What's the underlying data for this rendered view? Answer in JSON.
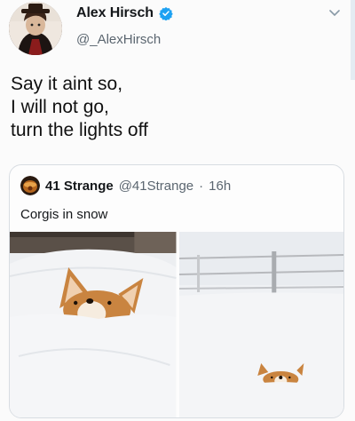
{
  "author": {
    "display_name": "Alex Hirsch",
    "handle": "@_AlexHirsch",
    "avatar_icon": "profile-avatar",
    "verified_icon": "verified-badge-icon"
  },
  "tweet": {
    "lines": [
      "Say it aint so,",
      "I will not go,",
      "turn the lights off"
    ]
  },
  "quoted": {
    "display_name": "41 Strange",
    "handle": "@41Strange",
    "separator": "·",
    "time": "16h",
    "text": "Corgis in snow",
    "avatar_icon": "profile-avatar"
  },
  "colors": {
    "verified_blue": "#1da1f2",
    "secondary_text": "#5b6670",
    "snow": "#f4f5f7",
    "corgi_orange": "#c98440"
  },
  "icons": {
    "menu": "chevron-down-icon"
  }
}
